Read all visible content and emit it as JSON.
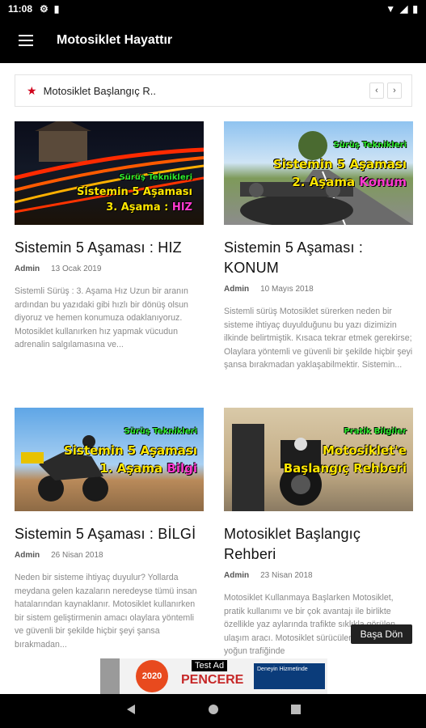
{
  "status": {
    "time": "11:08"
  },
  "appbar": {
    "title": "Motosiklet Hayattır"
  },
  "ticker": {
    "text": "Motosiklet Başlangıç R..",
    "prev": "‹",
    "next": "›"
  },
  "posts": [
    {
      "title": "Sistemin 5 Aşaması : HIZ",
      "author": "Admin",
      "date": "13 Ocak 2019",
      "excerpt": "Sistemli Sürüş : 3. Aşama Hız Uzun bir aranın ardından bu yazıdaki gibi hızlı bir dönüş olsun diyoruz ve hemen konumuza odaklanıyoruz. Motosiklet kullanırken hız yapmak vücudun adrenalin salgılamasına ve...",
      "thumb": {
        "line1": "Sürüş Teknikleri",
        "line2": "Sistemin 5 Aşaması",
        "line3": "3. Aşama : ",
        "highlight": "HIZ"
      }
    },
    {
      "title": "Sistemin 5 Aşaması : KONUM",
      "author": "Admin",
      "date": "10 Mayıs 2018",
      "excerpt": "Sistemli sürüş Motosiklet sürerken neden bir sisteme ihtiyaç duyulduğunu bu yazı dizimizin ilkinde belirtmiştik. Kısaca tekrar etmek gerekirse; Olaylara yöntemli ve güvenli bir şekilde hiçbir şeyi şansa bırakmadan yaklaşabilmektir. Sistemin...",
      "thumb": {
        "line1": "Sürüş Teknikleri",
        "line2": "Sistemin 5 Aşaması",
        "line3": "2. Aşama ",
        "highlight": "Konum"
      }
    },
    {
      "title": "Sistemin 5 Aşaması : BİLGİ",
      "author": "Admin",
      "date": "26 Nisan 2018",
      "excerpt": "Neden bir sisteme ihtiyaç duyulur? Yollarda meydana gelen kazaların neredeyse tümü insan hatalarından kaynaklanır. Motosiklet kullanırken bir sistem geliştirmenin amacı olaylara yöntemli ve güvenli bir şekilde hiçbir şeyi şansa bırakmadan...",
      "thumb": {
        "line1": "Sürüş Teknikleri",
        "line2": "Sistemin 5 Aşaması",
        "line3": "1. Aşama ",
        "highlight": "Bilgi"
      }
    },
    {
      "title": "Motosiklet Başlangıç Rehberi",
      "author": "Admin",
      "date": "23 Nisan 2018",
      "excerpt": "Motosiklet Kullanmaya Başlarken Motosiklet, pratik kullanımı ve bir çok avantajı ile birlikte özellikle yaz aylarında trafikte sıklıkla görülen ulaşım aracı. Motosiklet sürücüleri şehirlerin yoğun trafiğinde",
      "thumb": {
        "line1": "Pratik Bilgiler",
        "line2": "Motosiklet'e",
        "line3": "Başlangıç Rehberi",
        "highlight": ""
      }
    }
  ],
  "ad": {
    "label": "Test Ad",
    "brand": "PENCERE",
    "badge": "2020",
    "side": "Deneyin Hizmetinde"
  },
  "back_to_top": "Başa Dön"
}
